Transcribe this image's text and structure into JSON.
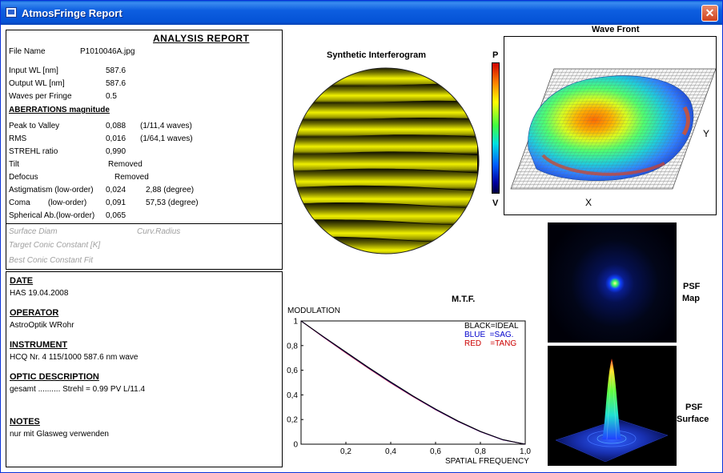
{
  "window": {
    "title": "AtmosFringe  Report",
    "close_glyph": "✕"
  },
  "report": {
    "heading": "ANALYSIS  REPORT",
    "file_name_label": "File Name",
    "file_name_value": "P1010046A.jpg",
    "input_wl_label": "Input  WL [nm]",
    "input_wl_value": "587.6",
    "output_wl_label": "Output WL [nm]",
    "output_wl_value": "587.6",
    "waves_label": "Waves per Fringe",
    "waves_value": "0.5",
    "aberr_heading": "ABERRATIONS magnitude",
    "ptv_label": "Peak to Valley",
    "ptv_value": "0,088",
    "ptv_waves": "(1/11,4 waves)",
    "rms_label": "RMS",
    "rms_value": "0,016",
    "rms_waves": "(1/64,1 waves)",
    "strehl_label": "STREHL ratio",
    "strehl_value": "0,990",
    "tilt_label": "Tilt",
    "tilt_value": "Removed",
    "defocus_label": "Defocus",
    "defocus_value": "Removed",
    "astig_label": "Astigmatism  (low-order)",
    "astig_value": "0,024",
    "astig_deg": "2,88  (degree)",
    "coma_label": "Coma        (low-order)",
    "coma_value": "0,091",
    "coma_deg": "57,53  (degree)",
    "spherical_label": "Spherical Ab.(low-order)",
    "spherical_value": "0,065",
    "surface_diam_label": "Surface Diam",
    "curv_radius_label": "Curv.Radius",
    "target_conic_label": "Target Conic Constant [K]",
    "best_conic_label": "Best Conic Constant Fit"
  },
  "info": {
    "date_heading": "DATE",
    "date_value": "HAS 19.04.2008",
    "operator_heading": "OPERATOR",
    "operator_value": "AstroOptik WRohr",
    "instrument_heading": "INSTRUMENT",
    "instrument_value": "HCQ Nr. 4 115/1000  587.6 nm wave",
    "optic_heading": "OPTIC DESCRIPTION",
    "optic_value": "gesamt .......... Strehl = 0.99  PV  L/11.4",
    "notes_heading": "NOTES",
    "notes_value": "nur mit Glasweg verwenden"
  },
  "interferogram": {
    "title": "Synthetic Interferogram",
    "fringe_count": 11
  },
  "colorbar": {
    "top_label": "P",
    "bottom_label": "V"
  },
  "wavefront": {
    "title": "Wave Front",
    "x_label": "X",
    "y_label": "Y"
  },
  "psf": {
    "map_label_1": "PSF",
    "map_label_2": "Map",
    "surface_label_1": "PSF",
    "surface_label_2": "Surface"
  },
  "chart_data": {
    "type": "line",
    "title": "M.T.F.",
    "ylabel": "MODULATION",
    "xlabel": "SPATIAL FREQUENCY",
    "xlim": [
      0,
      1
    ],
    "ylim": [
      0,
      1
    ],
    "x_ticks": [
      "0,2",
      "0,4",
      "0,6",
      "0,8",
      "1,0"
    ],
    "y_ticks": [
      "0",
      "0,2",
      "0,4",
      "0,6",
      "0,8",
      "1"
    ],
    "legend": [
      "BLACK=IDEAL",
      "BLUE  =SAG.",
      "RED    =TANG"
    ],
    "x": [
      0,
      0.1,
      0.2,
      0.3,
      0.4,
      0.5,
      0.6,
      0.7,
      0.8,
      0.9,
      1.0
    ],
    "series": [
      {
        "name": "IDEAL",
        "color": "#000000",
        "values": [
          1.0,
          0.873,
          0.748,
          0.624,
          0.505,
          0.391,
          0.285,
          0.188,
          0.104,
          0.037,
          0.0
        ]
      },
      {
        "name": "SAG.",
        "color": "#0000cc",
        "values": [
          1.0,
          0.87,
          0.744,
          0.62,
          0.501,
          0.388,
          0.282,
          0.186,
          0.102,
          0.036,
          0.0
        ]
      },
      {
        "name": "TANG",
        "color": "#cc0000",
        "values": [
          1.0,
          0.868,
          0.74,
          0.616,
          0.497,
          0.385,
          0.28,
          0.184,
          0.101,
          0.035,
          0.0
        ]
      }
    ]
  }
}
